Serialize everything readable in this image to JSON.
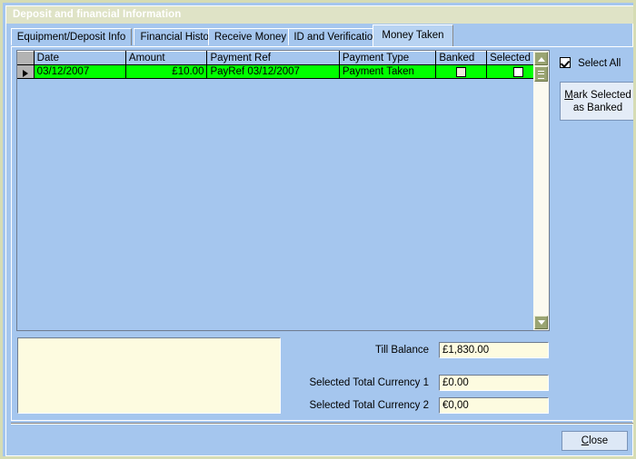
{
  "window": {
    "title": "Deposit and financial Information"
  },
  "tabs": [
    {
      "label": "Equipment/Deposit Info",
      "active": false
    },
    {
      "label": "Financial History",
      "active": false
    },
    {
      "label": "Receive Money",
      "active": false
    },
    {
      "label": "ID and Verification",
      "active": false
    },
    {
      "label": "Money Taken",
      "active": true
    }
  ],
  "grid": {
    "columns": [
      "Date",
      "Amount",
      "Payment Ref",
      "Payment Type",
      "Banked",
      "Selected"
    ],
    "rows": [
      {
        "selected": true,
        "date": "03/12/2007",
        "amount": "£10.00",
        "payment_ref": "PayRef 03/12/2007",
        "payment_type": "Payment Taken",
        "banked": false,
        "selected_check": false
      }
    ]
  },
  "side_panel": {
    "select_all_label": "Select All",
    "select_all_checked": true,
    "mark_button": {
      "accel": "M",
      "rest_line1": "ark Selected",
      "line2": "as Banked"
    }
  },
  "notes": {
    "value": "",
    "placeholder": ""
  },
  "fields": [
    {
      "label": "Till Balance",
      "value": "£1,830.00"
    },
    {
      "label": "Selected Total Currency 1",
      "value": "£0.00"
    },
    {
      "label": "Selected Total Currency 2",
      "value": "€0,00"
    }
  ],
  "footer": {
    "close_accel": "C",
    "close_rest": "lose"
  },
  "colors": {
    "form_background": "#a5c6ee",
    "title_bar": "#dfe3c6",
    "window_border": "#d6dcb4",
    "selected_row": "#00ff00",
    "field_background": "#fdfbe0",
    "scrollbar_thumb": "#9aa472"
  }
}
